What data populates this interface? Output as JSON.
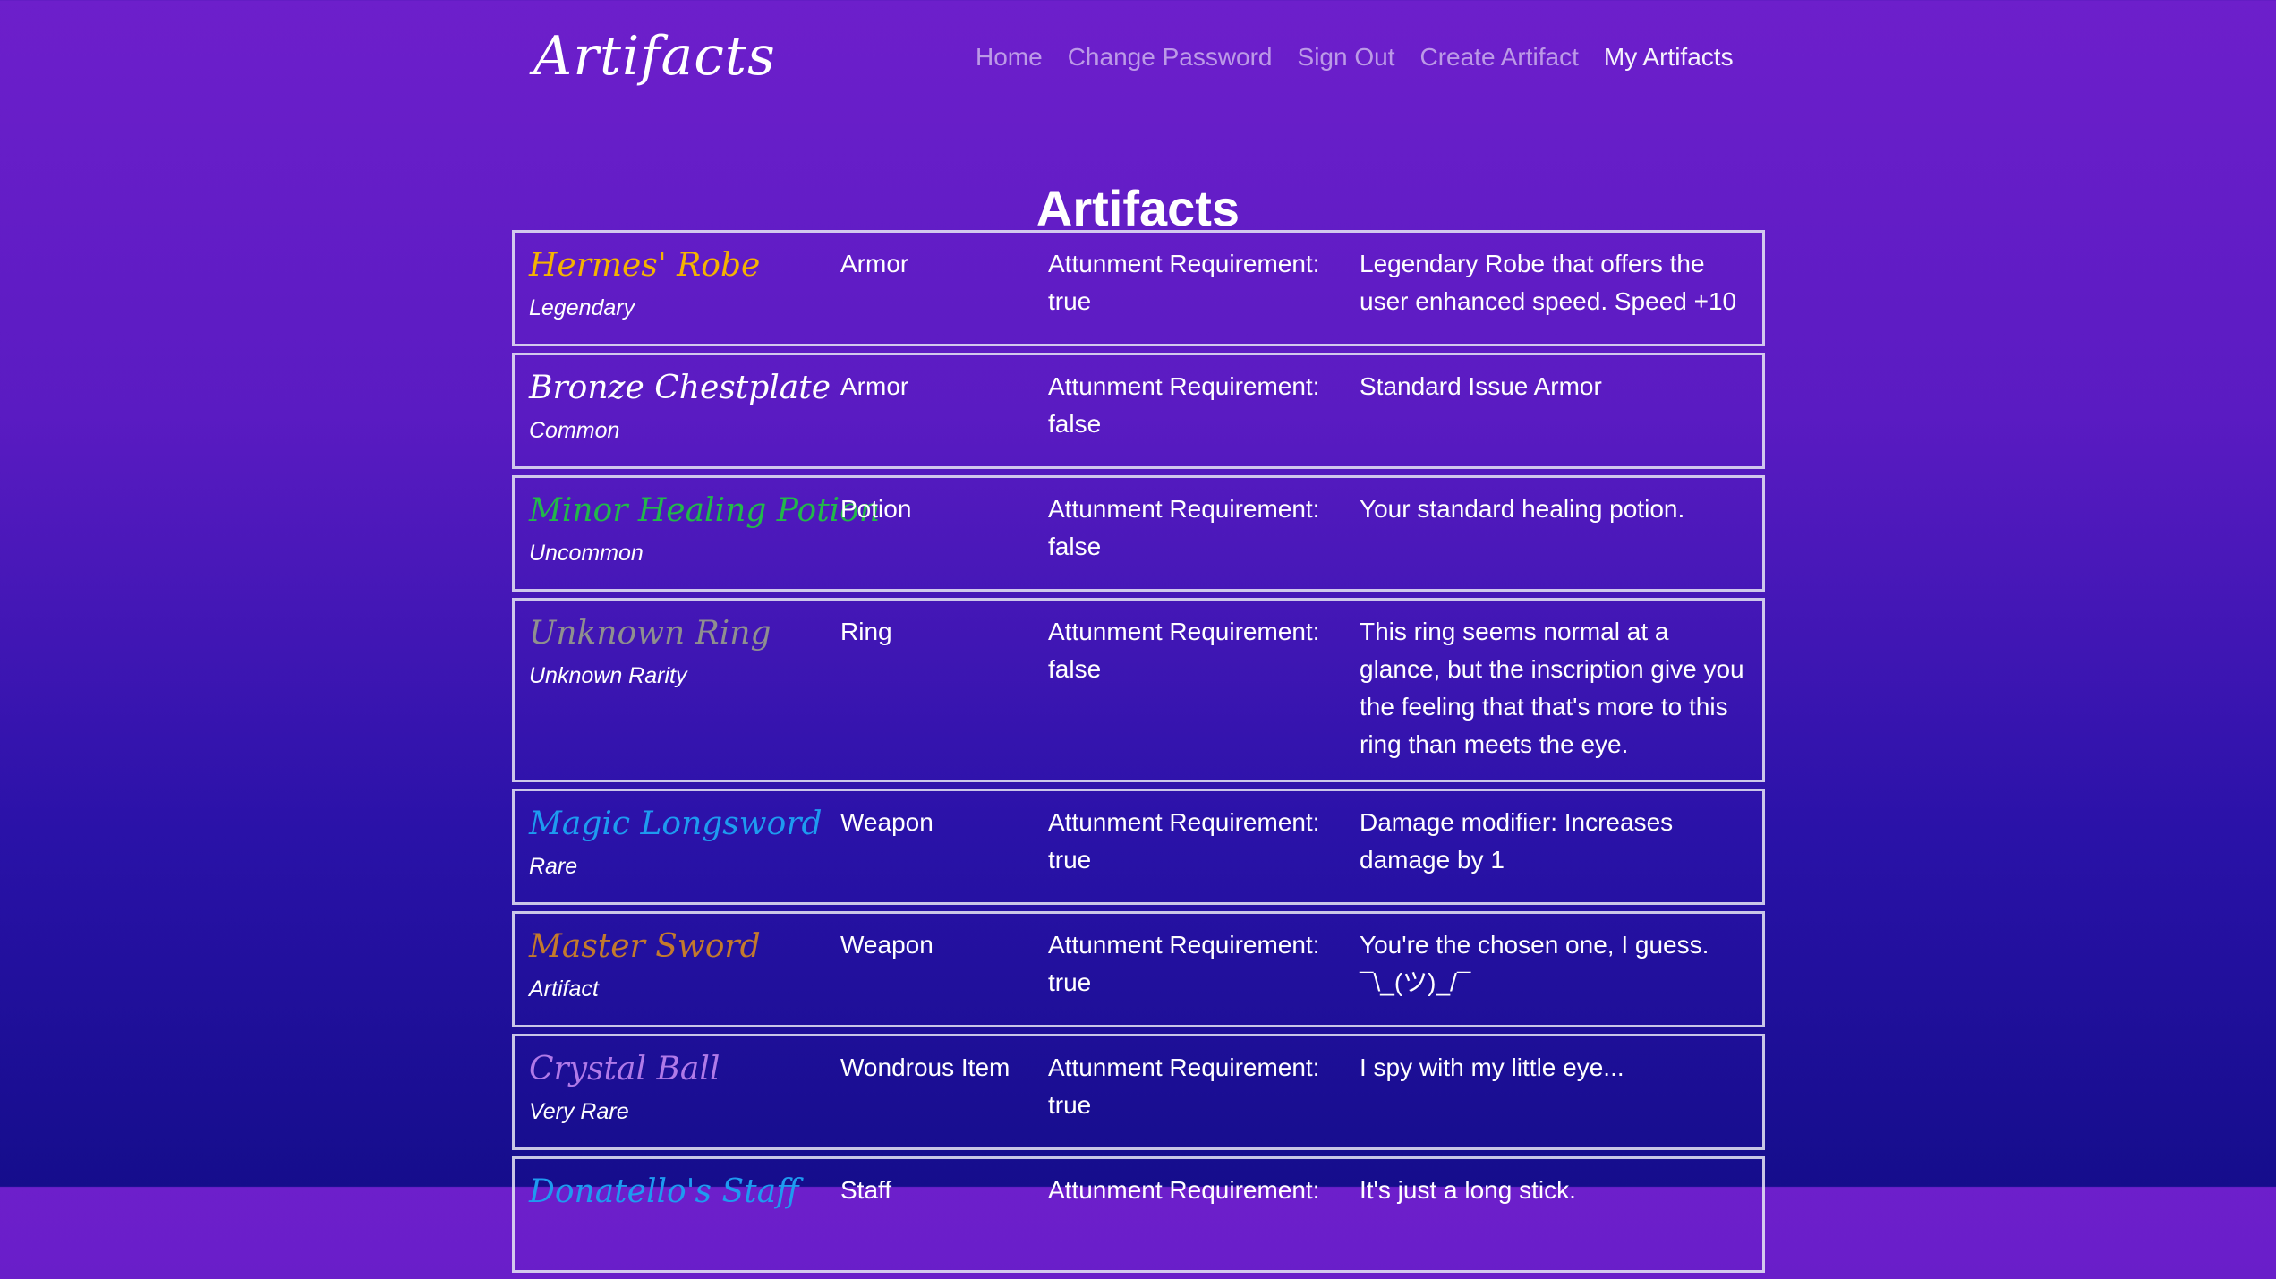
{
  "header": {
    "brand": "Artifacts",
    "nav": [
      {
        "label": "Home",
        "active": false
      },
      {
        "label": "Change Password",
        "active": false
      },
      {
        "label": "Sign Out",
        "active": false
      },
      {
        "label": "Create Artifact",
        "active": false
      },
      {
        "label": "My Artifacts",
        "active": true
      }
    ]
  },
  "main": {
    "title": "Artifacts",
    "attunement_label": "Attunment Requirement:",
    "items": [
      {
        "name": "Hermes' Robe",
        "rarity": "Legendary",
        "type": "Armor",
        "attunement": "true",
        "description": "Legendary Robe that offers the user enhanced speed. Speed +10",
        "color": "#f5b301"
      },
      {
        "name": "Bronze Chestplate",
        "rarity": "Common",
        "type": "Armor",
        "attunement": "false",
        "description": "Standard Issue Armor",
        "color": "#ffffff"
      },
      {
        "name": "Minor Healing Potion",
        "rarity": "Uncommon",
        "type": "Potion",
        "attunement": "false",
        "description": "Your standard healing potion.",
        "color": "#22b84a"
      },
      {
        "name": "Unknown Ring",
        "rarity": "Unknown Rarity",
        "type": "Ring",
        "attunement": "false",
        "description": "This ring seems normal at a glance, but the inscription give you the feeling that that's more to this ring than meets the eye.",
        "color": "#8f8f8f"
      },
      {
        "name": "Magic Longsword",
        "rarity": "Rare",
        "type": "Weapon",
        "attunement": "true",
        "description": "Damage modifier: Increases damage by 1",
        "color": "#1e9bf0"
      },
      {
        "name": "Master Sword",
        "rarity": "Artifact",
        "type": "Weapon",
        "attunement": "true",
        "description": "You're the chosen one, I guess. ¯\\_(ツ)_/¯",
        "color": "#c47a2c"
      },
      {
        "name": "Crystal Ball",
        "rarity": "Very Rare",
        "type": "Wondrous Item",
        "attunement": "true",
        "description": "I spy with my little eye...",
        "color": "#b07ae8"
      },
      {
        "name": "Donatello's Staff",
        "rarity": "",
        "type": "Staff",
        "attunement": "",
        "description": "It's just a long stick.",
        "color": "#1e9bf0"
      }
    ]
  }
}
